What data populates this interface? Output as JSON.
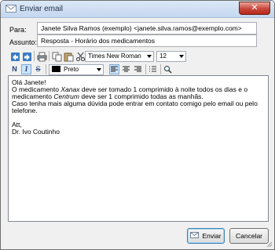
{
  "window": {
    "title": "Enviar email",
    "close_glyph": "✕"
  },
  "fields": {
    "to_label": "Para:",
    "to_value": "Janete Silva Ramos (exemplo) <janete.silva.ramos@exemplo.com>",
    "subject_label": "Assunto:",
    "subject_value": "Resposta - Horário dos medicamentos"
  },
  "toolbar": {
    "row1_icons": [
      "open-file-icon",
      "save-file-icon",
      "print-icon",
      "copy-icon",
      "paste-icon",
      "cut-icon"
    ],
    "font_family": "Times New Roman",
    "font_size": "12",
    "row2_icons": [
      "bold-icon",
      "italic-icon",
      "strikethrough-icon",
      "align-left-icon",
      "align-center-icon",
      "align-right-icon",
      "list-icon",
      "find-icon"
    ],
    "bold_glyph": "N",
    "italic_glyph": "I",
    "strike_glyph": "S",
    "color_name": "Preto",
    "color_hex": "#000000"
  },
  "message": {
    "greeting": "Olá Janete!",
    "line2_pre": "O medicamento ",
    "line2_em1": "Xanax",
    "line2_mid": " deve ser tomado 1 comprimido à noite todos os dias e o",
    "line3_pre": "medicamento ",
    "line3_em2": "Centrum",
    "line3_post": " deve ser 1 comprimido todas as manhãs.",
    "line4": "Caso tenha mais alguma dúvida pode entrar em contato comigo pelo email ou pelo",
    "line5": "telefone.",
    "signoff": "Att,",
    "signature": "Dr. Ivo Coutinho"
  },
  "buttons": {
    "send": "Enviar",
    "cancel": "Cancelar"
  },
  "colors": {
    "accent": "#3c7fb1",
    "title_bar": "#c4d7ef",
    "close": "#c9453a"
  }
}
